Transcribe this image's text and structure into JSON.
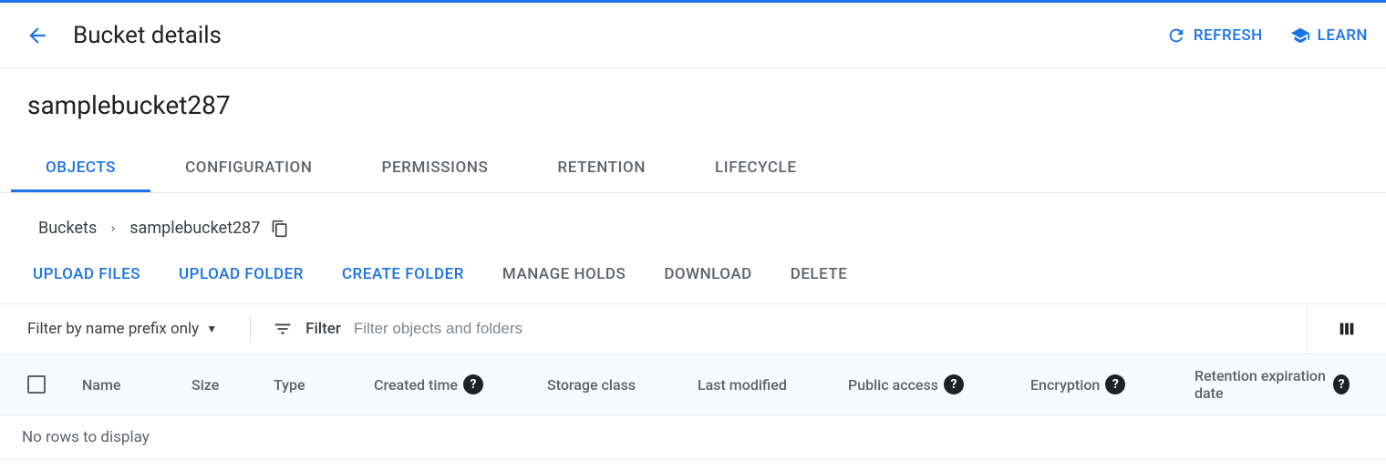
{
  "header": {
    "title": "Bucket details",
    "refresh": "REFRESH",
    "learn": "LEARN"
  },
  "bucket": {
    "name": "samplebucket287"
  },
  "tabs": [
    {
      "label": "OBJECTS",
      "active": true
    },
    {
      "label": "CONFIGURATION",
      "active": false
    },
    {
      "label": "PERMISSIONS",
      "active": false
    },
    {
      "label": "RETENTION",
      "active": false
    },
    {
      "label": "LIFECYCLE",
      "active": false
    }
  ],
  "breadcrumb": {
    "root": "Buckets",
    "current": "samplebucket287"
  },
  "actions": {
    "upload_files": "UPLOAD FILES",
    "upload_folder": "UPLOAD FOLDER",
    "create_folder": "CREATE FOLDER",
    "manage_holds": "MANAGE HOLDS",
    "download": "DOWNLOAD",
    "delete": "DELETE"
  },
  "filter": {
    "prefix_label": "Filter by name prefix only",
    "filter_label": "Filter",
    "placeholder": "Filter objects and folders"
  },
  "columns": {
    "name": "Name",
    "size": "Size",
    "type": "Type",
    "created": "Created time",
    "storage": "Storage class",
    "modified": "Last modified",
    "public": "Public access",
    "encryption": "Encryption",
    "retention": "Retention expiration date"
  },
  "table": {
    "empty": "No rows to display"
  }
}
